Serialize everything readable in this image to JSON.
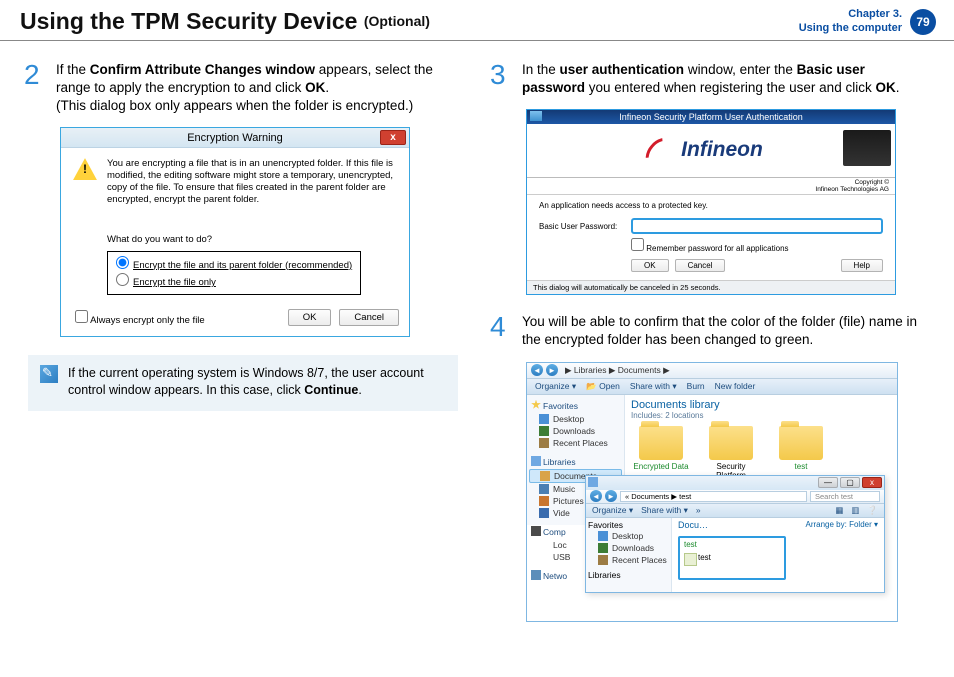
{
  "header": {
    "title_main": "Using the TPM Security Device",
    "title_optional": "(Optional)",
    "chapter_line1": "Chapter 3.",
    "chapter_line2": "Using the computer",
    "page_number": "79"
  },
  "step2": {
    "num": "2",
    "p1a": "If the ",
    "p1b": "Confirm Attribute Changes window",
    "p1c": " appears, select the range to apply the encryption to and click ",
    "p1d": "OK",
    "p1e": ".",
    "p2": "(This dialog box only appears when the folder is encrypted.)"
  },
  "dialog1": {
    "title": "Encryption Warning",
    "close": "x",
    "message": "You are encrypting a file that is in an unencrypted folder. If this file is modified, the editing software might store a temporary, unencrypted, copy of the file. To ensure that files created in the parent folder are encrypted, encrypt the parent folder.",
    "prompt": "What do you want to do?",
    "option1": "Encrypt the file and its parent folder (recommended)",
    "option2": "Encrypt the file only",
    "always": "Always encrypt only the file",
    "ok": "OK",
    "cancel": "Cancel"
  },
  "note": {
    "text_a": "If the current operating system is Windows 8/7, the user account control window appears. In this case, click ",
    "text_b": "Continue",
    "text_c": "."
  },
  "step3": {
    "num": "3",
    "p1a": "In the ",
    "p1b": "user authentication",
    "p1c": " window, enter the ",
    "p1d": "Basic user password",
    "p1e": " you entered when registering the user and click ",
    "p1f": "OK",
    "p1g": "."
  },
  "dialog2": {
    "title": "Infineon Security Platform User Authentication",
    "logo": "Infineon",
    "copyright1": "Copyright ©",
    "copyright2": "Infineon Technologies AG",
    "msg": "An application needs access to a protected key.",
    "field_label": "Basic User Password:",
    "remember": "Remember password for all applications",
    "ok": "OK",
    "cancel": "Cancel",
    "help": "Help",
    "footer": "This dialog will automatically be canceled in 25 seconds."
  },
  "step4": {
    "num": "4",
    "text": "You will be able to confirm that the color of the folder (file) name in the encrypted folder has been changed to green."
  },
  "explorer": {
    "breadcrumb": "▶ Libraries ▶ Documents ▶",
    "toolbar": {
      "organize": "Organize ▾",
      "open": "Open",
      "share": "Share with ▾",
      "burn": "Burn",
      "newfolder": "New folder"
    },
    "lib_title": "Documents library",
    "lib_sub": "Includes: 2 locations",
    "sidebar": {
      "favorites": "Favorites",
      "desktop": "Desktop",
      "downloads": "Downloads",
      "recent": "Recent Places",
      "libraries": "Libraries",
      "documents": "Documents",
      "music": "Music",
      "pictures": "Pictures",
      "videos": "Vide",
      "computer": "Comp",
      "local": "Loc",
      "usb": "USB",
      "network": "Netwo"
    },
    "folders": {
      "encrypted": "Encrypted Data",
      "security": "Security Platform",
      "test": "test"
    },
    "inner": {
      "addr": "« Documents ▶ test",
      "search_placeholder": "Search test",
      "organize": "Organize ▾",
      "share": "Share with ▾",
      "more": "»",
      "title": "Docu…",
      "arrange_label": "Arrange by:",
      "arrange_value": "Folder ▾",
      "group": "test",
      "file": "test"
    }
  }
}
